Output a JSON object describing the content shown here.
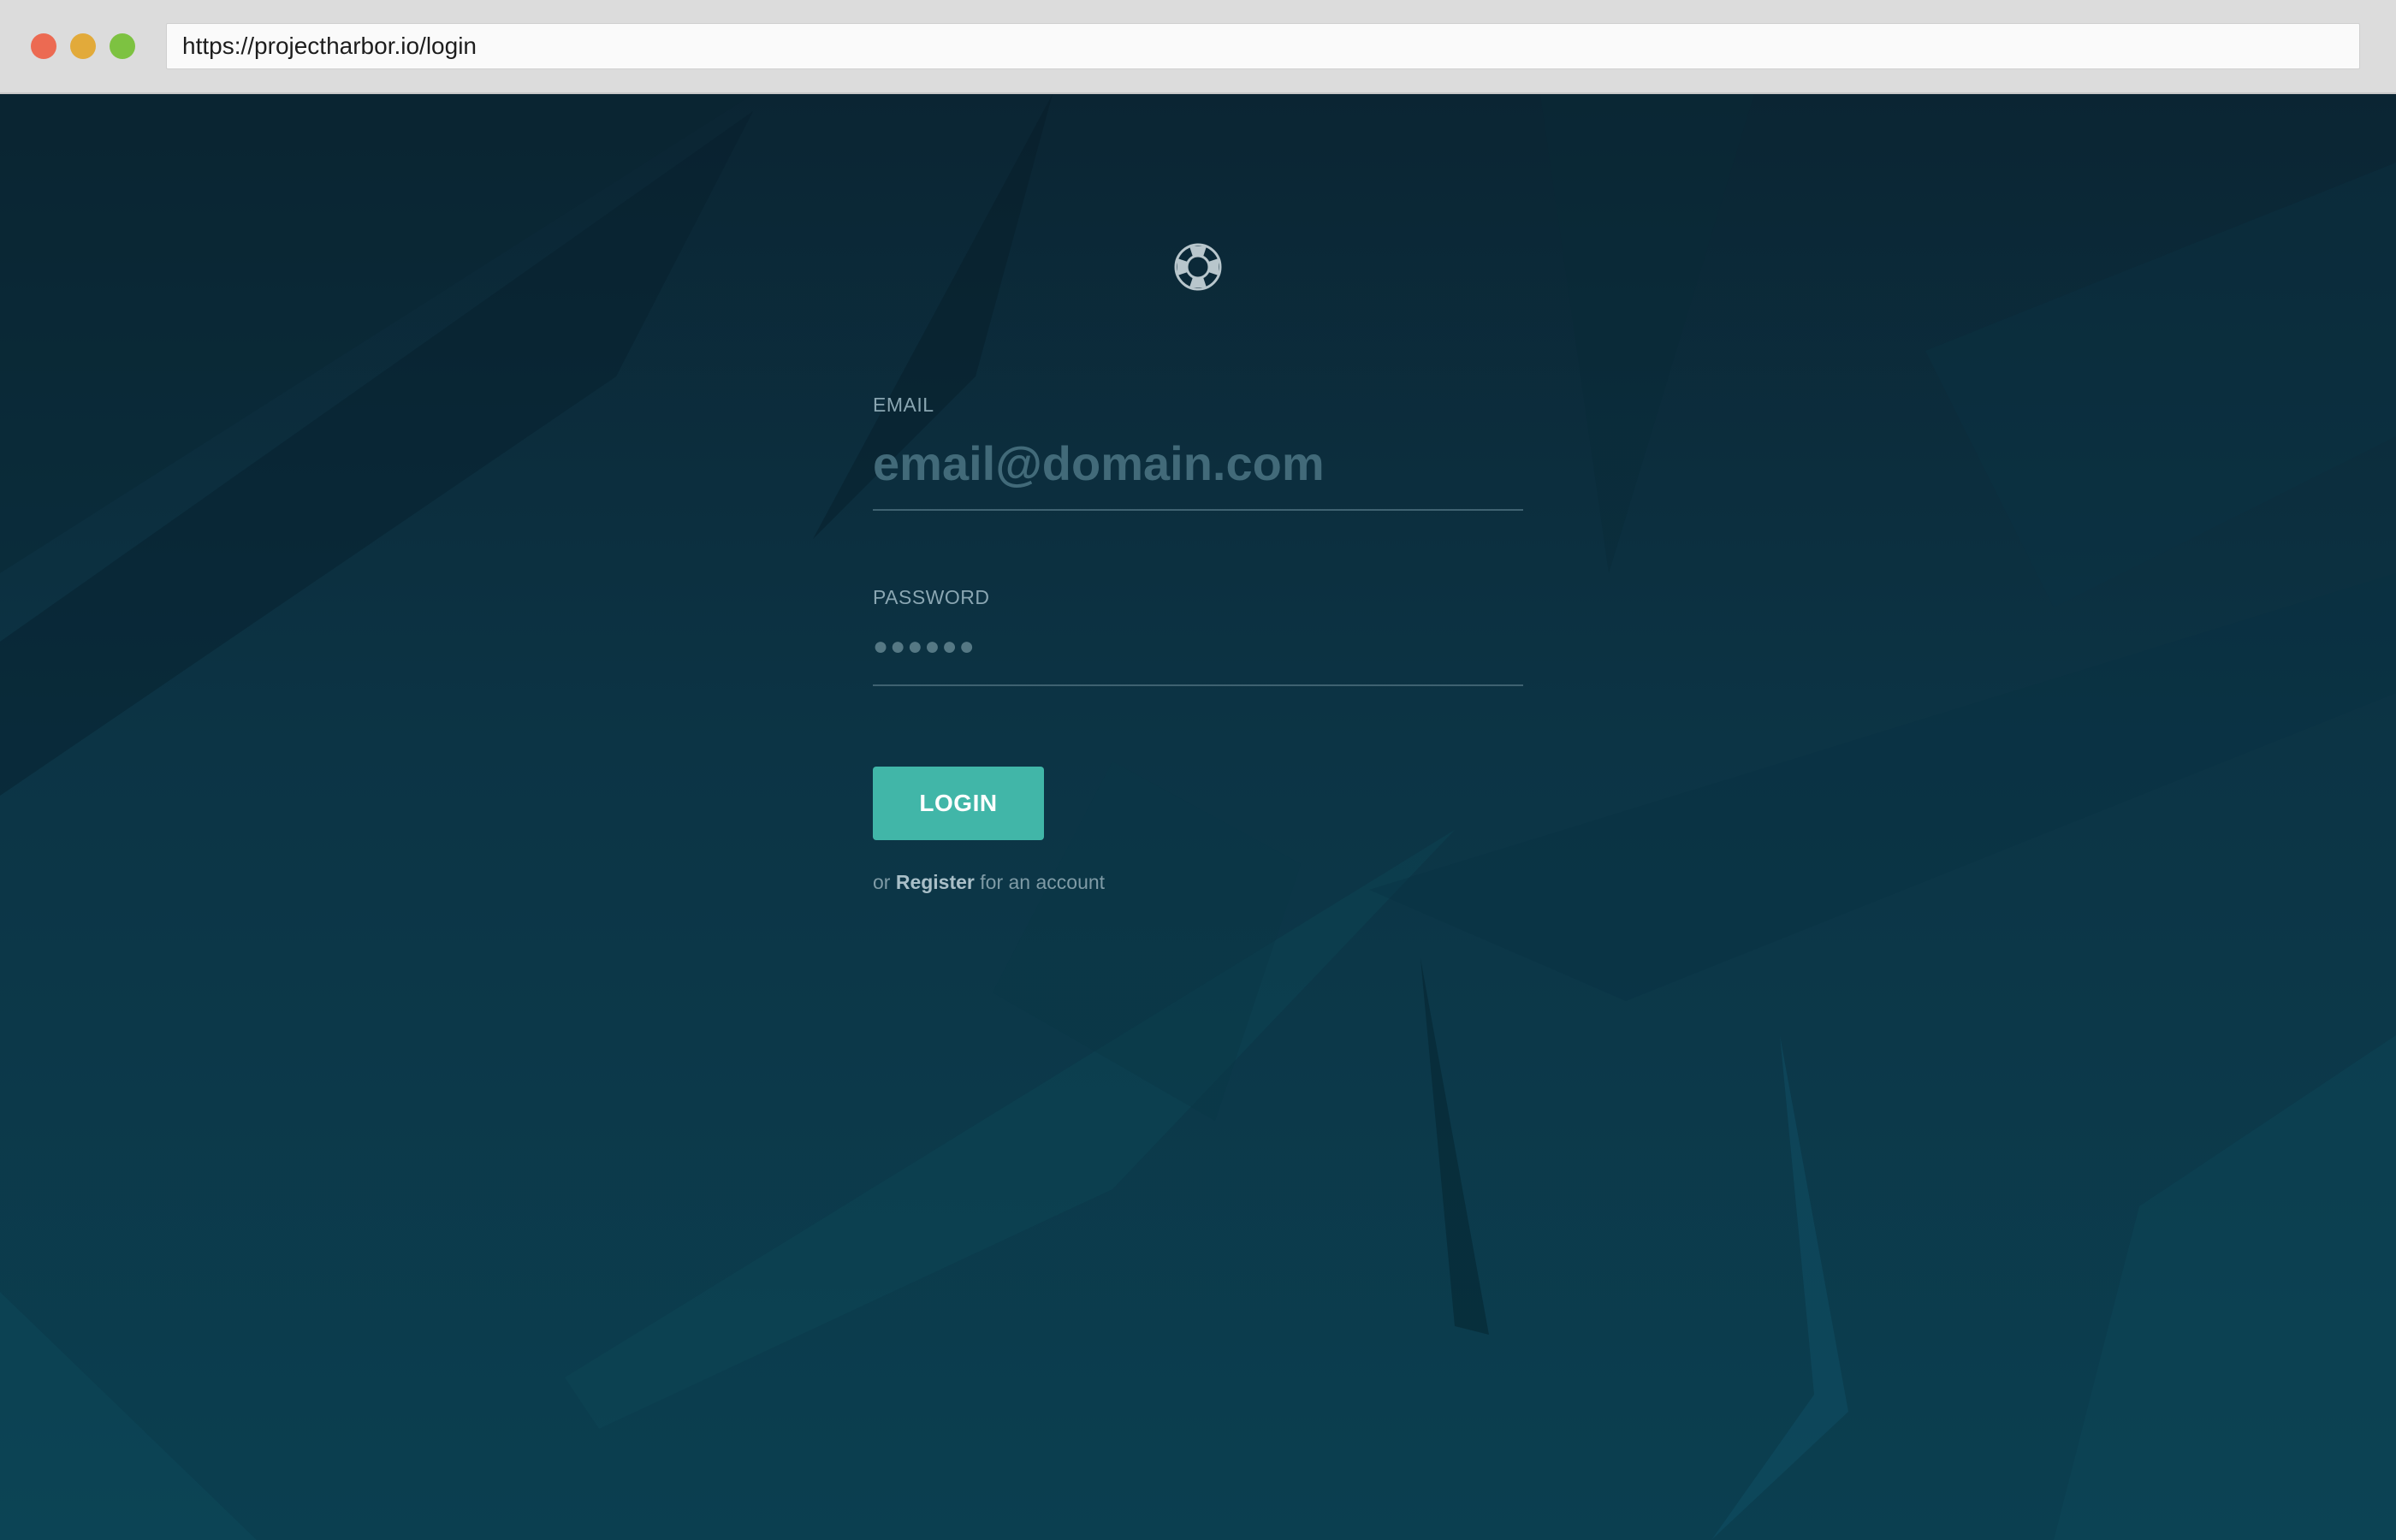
{
  "browser": {
    "url": "https://projectharbor.io/login"
  },
  "logo": {
    "icon": "lifebuoy-icon"
  },
  "form": {
    "email_label": "EMAIL",
    "email_placeholder": "email@domain.com",
    "password_label": "PASSWORD",
    "password_placeholder": "●●●●●●",
    "login_label": "LOGIN",
    "register_prefix": "or",
    "register_link": "Register",
    "register_suffix": "for an account"
  },
  "colors": {
    "accent": "#41b6a8",
    "background_top": "#0b2533",
    "background_bottom": "#0b3f50"
  }
}
